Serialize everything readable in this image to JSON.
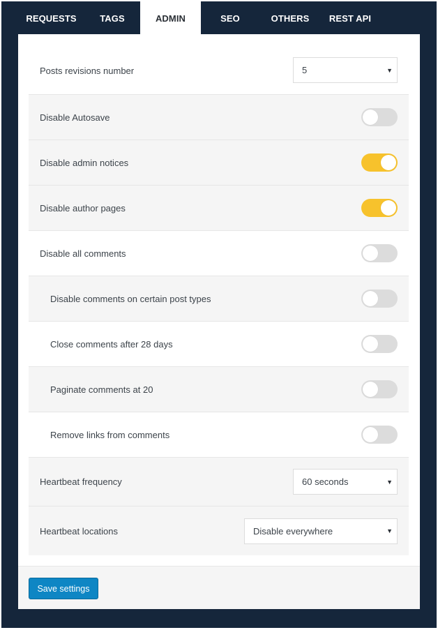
{
  "tabs": [
    {
      "label": "REQUESTS",
      "active": false
    },
    {
      "label": "TAGS",
      "active": false
    },
    {
      "label": "ADMIN",
      "active": true
    },
    {
      "label": "SEO",
      "active": false
    },
    {
      "label": "OTHERS",
      "active": false
    },
    {
      "label": "REST API",
      "active": false
    }
  ],
  "settings": {
    "posts_revisions": {
      "label": "Posts revisions number",
      "value": "5"
    },
    "disable_autosave": {
      "label": "Disable Autosave",
      "enabled": false
    },
    "disable_admin_notices": {
      "label": "Disable admin notices",
      "enabled": true
    },
    "disable_author_pages": {
      "label": "Disable author pages",
      "enabled": true
    },
    "disable_all_comments": {
      "label": "Disable all comments",
      "enabled": false
    },
    "disable_comments_post_types": {
      "label": "Disable comments on certain post types",
      "enabled": false
    },
    "close_comments": {
      "label": "Close comments after 28 days",
      "enabled": false
    },
    "paginate_comments": {
      "label": "Paginate comments at 20",
      "enabled": false
    },
    "remove_links": {
      "label": "Remove links from comments",
      "enabled": false
    },
    "heartbeat_frequency": {
      "label": "Heartbeat frequency",
      "value": "60 seconds"
    },
    "heartbeat_locations": {
      "label": "Heartbeat locations",
      "value": "Disable everywhere"
    }
  },
  "footer": {
    "save_label": "Save settings"
  },
  "colors": {
    "toggle_on": "#f7c22c",
    "toggle_off": "#dcdcdc",
    "button": "#0e86c4",
    "frame": "#15263b"
  }
}
